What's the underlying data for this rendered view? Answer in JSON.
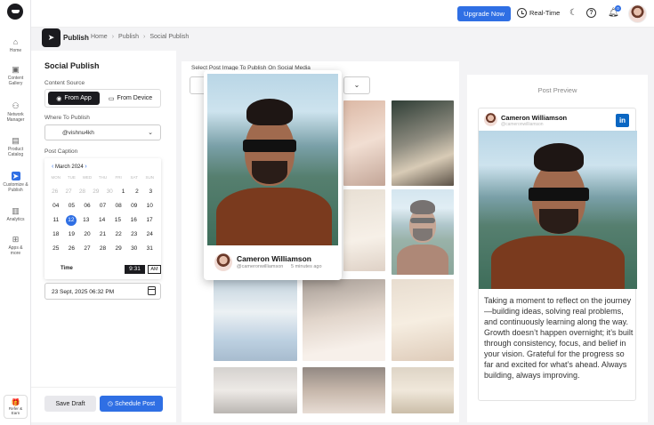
{
  "sidebar": {
    "items": [
      {
        "label": "Home",
        "icon": "home-icon"
      },
      {
        "label": "Content Gallery",
        "icon": "image-icon"
      },
      {
        "label": "Network Manager",
        "icon": "network-icon"
      },
      {
        "label": "Product Catalog",
        "icon": "catalog-icon"
      },
      {
        "label": "Customize & Publish",
        "icon": "send-icon",
        "active": true
      },
      {
        "label": "Analytics",
        "icon": "bar-chart-icon"
      },
      {
        "label": "Apps & more",
        "icon": "grid-icon"
      }
    ],
    "refer": "Refer & Earn"
  },
  "topbar": {
    "upgrade_label": "Upgrade Now",
    "realtime_label": "Real-Time",
    "notification_count": "0",
    "accent": "#2f6fe4"
  },
  "header": {
    "title": "Publish",
    "breadcrumbs": [
      "Home",
      "Publish",
      "Social Publish"
    ]
  },
  "form": {
    "title": "Social Publish",
    "content_source_label": "Content Source",
    "from_app": "From App",
    "from_device": "From Device",
    "where_label": "Where To Publish",
    "account": "@vishnu4kh",
    "caption_label": "Post Caption",
    "calendar": {
      "month": "March 2024",
      "weekdays": [
        "MON",
        "TUE",
        "WED",
        "THU",
        "FRI",
        "SAT",
        "SUN"
      ],
      "weeks": [
        [
          "26",
          "27",
          "28",
          "29",
          "30",
          "1",
          "2",
          "3"
        ],
        [
          "04",
          "05",
          "06",
          "07",
          "08",
          "09",
          "10"
        ],
        [
          "11",
          "12",
          "13",
          "14",
          "15",
          "16",
          "17"
        ],
        [
          "18",
          "19",
          "20",
          "21",
          "22",
          "23",
          "24"
        ],
        [
          "25",
          "26",
          "27",
          "28",
          "29",
          "30",
          "31"
        ]
      ],
      "selected": "12",
      "time_label": "Time",
      "time_value": "9:31",
      "ampm": "AM"
    },
    "date_value": "23 Sept, 2025 06:32 PM",
    "save_draft": "Save Draft",
    "schedule_post": "Schedule Post"
  },
  "media": {
    "label": "Select Post Image To Publish On Social Media"
  },
  "popup": {
    "name": "Cameron Williamson",
    "handle": "@cameronwilliamson",
    "time": "5 minutes ago"
  },
  "preview": {
    "title": "Post Preview",
    "name": "Cameron Williamson",
    "handle": "@cameronwilliamson",
    "network_icon": "linkedin-icon",
    "text": "Taking a moment to reflect on the journey—building ideas, solving real problems, and continuously learning along the way. Growth doesn’t happen overnight; it’s built through consistency, focus, and belief in your vision. Grateful for the progress so far and excited for what’s ahead. Always building, always improving."
  }
}
